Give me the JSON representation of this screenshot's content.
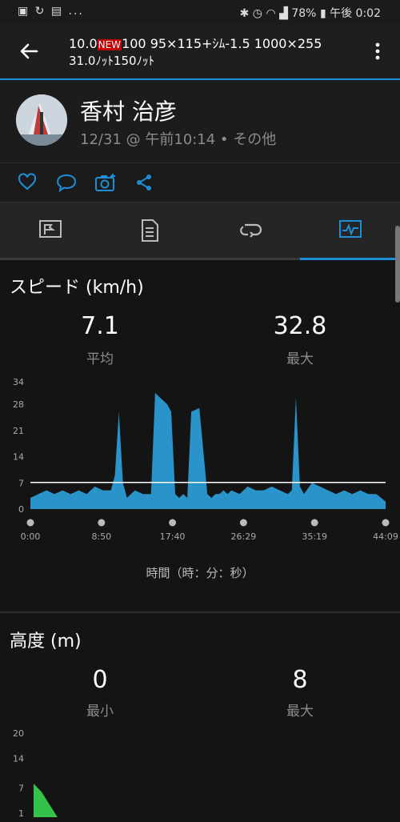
{
  "status_bar": {
    "left": "▣ ↻ ▤ ...",
    "battery": "78%",
    "time": "午後 0:02"
  },
  "header": {
    "title_line1_a": "10.0",
    "title_badge": "NEW",
    "title_line1_b": "100 95×115+ｼﾑ-1.5 1000×255",
    "title_line2": "31.0ﾉｯﾄ150ﾉｯﾄ"
  },
  "profile": {
    "name": "香村 治彦",
    "subtitle": "12/31 @ 午前10:14 • その他"
  },
  "colors": {
    "accent": "#1d8fd6",
    "speed_fill": "#2a93c9",
    "altitude_fill": "#35c24a"
  },
  "speed": {
    "title": "スピード (km/h)",
    "avg_value": "7.1",
    "avg_label": "平均",
    "max_value": "32.8",
    "max_label": "最大",
    "axis_title": "時間（時：分：秒）"
  },
  "altitude": {
    "title": "高度 (m)",
    "min_value": "0",
    "min_label": "最小",
    "max_value": "8",
    "max_label": "最大"
  },
  "chart_data": [
    {
      "type": "area",
      "ylim": [
        0,
        34
      ],
      "yticks": [
        "34",
        "28",
        "21",
        "14",
        "7",
        "0"
      ],
      "ytick_values": [
        34,
        28,
        21,
        14,
        7,
        0
      ],
      "xticks": [
        "0:00",
        "8:50",
        "17:40",
        "26:29",
        "35:19",
        "44:09"
      ],
      "reference_line": 7.1,
      "x_minutes": [
        0,
        1,
        2,
        3,
        4,
        5,
        6,
        7,
        8,
        9,
        10,
        10.5,
        11,
        11.5,
        12,
        12.5,
        13,
        14,
        15,
        15.5,
        16,
        16.5,
        17,
        17.5,
        18,
        18.5,
        19,
        19.5,
        20,
        21,
        22,
        22.5,
        23,
        23.5,
        24,
        24.5,
        25,
        26,
        27,
        28,
        29,
        30,
        31,
        32,
        32.5,
        33,
        33.5,
        34,
        35,
        36,
        37,
        38,
        39,
        40,
        41,
        42,
        43,
        44.15
      ],
      "values": [
        3,
        4,
        5,
        4,
        5,
        4,
        5,
        4,
        6,
        5,
        5,
        9,
        26,
        7,
        3,
        4,
        5,
        4,
        4,
        31,
        30,
        29,
        28,
        26,
        4,
        3,
        4,
        3,
        26,
        27,
        4,
        3,
        4,
        4,
        5,
        4,
        5,
        4,
        6,
        5,
        5,
        6,
        5,
        4,
        5,
        30,
        6,
        4,
        7,
        6,
        5,
        4,
        5,
        4,
        5,
        4,
        4,
        2
      ]
    },
    {
      "type": "area",
      "ylim": [
        0,
        20
      ],
      "yticks": [
        "20",
        "14",
        "7",
        "1"
      ],
      "ytick_values": [
        20,
        14,
        7,
        1
      ],
      "x_minutes": [
        0,
        1,
        2,
        3,
        4,
        44.15
      ],
      "values": [
        8,
        6,
        3,
        0,
        0,
        0
      ]
    }
  ]
}
